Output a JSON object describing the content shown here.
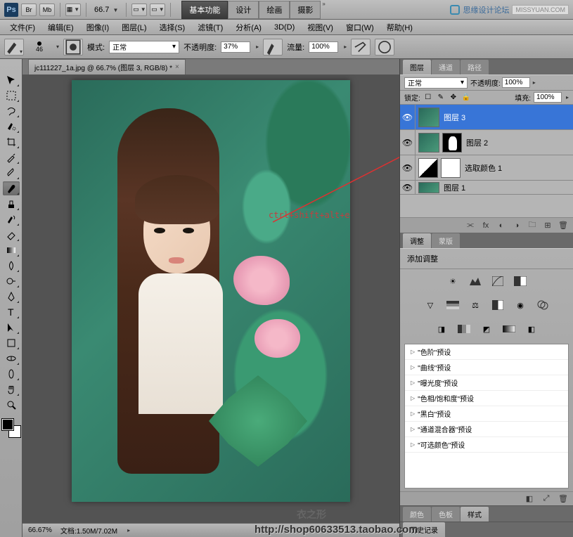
{
  "topbar": {
    "br": "Br",
    "mb": "Mb",
    "zoom": "66.7",
    "workspaces": [
      "基本功能",
      "设计",
      "绘画",
      "摄影"
    ],
    "forum": "思缘设计论坛",
    "logo_text": "MISSYUAN.COM"
  },
  "menu": [
    "文件(F)",
    "编辑(E)",
    "图像(I)",
    "图层(L)",
    "选择(S)",
    "滤镜(T)",
    "分析(A)",
    "3D(D)",
    "视图(V)",
    "窗口(W)",
    "帮助(H)"
  ],
  "options": {
    "brush_size": "46",
    "mode_label": "模式:",
    "mode_value": "正常",
    "opacity_label": "不透明度:",
    "opacity_value": "37%",
    "flow_label": "流量:",
    "flow_value": "100%"
  },
  "document": {
    "tab": "jc111227_1a.jpg @ 66.7% (图层 3, RGB/8) *",
    "annotation": "ctrl+shift+alt+e"
  },
  "status": {
    "zoom": "66.67%",
    "doc_size": "文档:1.50M/7.02M"
  },
  "layers_panel": {
    "tabs": [
      "图层",
      "通道",
      "路径"
    ],
    "blend": "正常",
    "opacity_label": "不透明度:",
    "opacity": "100%",
    "lock_label": "锁定:",
    "fill_label": "填充:",
    "fill": "100%",
    "layers": [
      {
        "name": "图层 3",
        "selected": true,
        "type": "image"
      },
      {
        "name": "图层 2",
        "selected": false,
        "type": "image_mask"
      },
      {
        "name": "选取颜色 1",
        "selected": false,
        "type": "adjustment"
      },
      {
        "name": "图层 1",
        "selected": false,
        "type": "image"
      }
    ]
  },
  "adj_panel": {
    "tabs": [
      "调整",
      "蒙版"
    ],
    "title": "添加调整",
    "presets": [
      "\"色阶\"预设",
      "\"曲线\"预设",
      "\"曝光度\"预设",
      "\"色相/饱和度\"预设",
      "\"黑白\"预设",
      "\"通道混合器\"预设",
      "\"可选颜色\"预设"
    ]
  },
  "bottom_tabs1": [
    "颜色",
    "色板",
    "样式"
  ],
  "bottom_tabs2": [
    "历史记录"
  ],
  "watermark1": "衣之形",
  "watermark2": "http://shop60633513.taobao.com"
}
